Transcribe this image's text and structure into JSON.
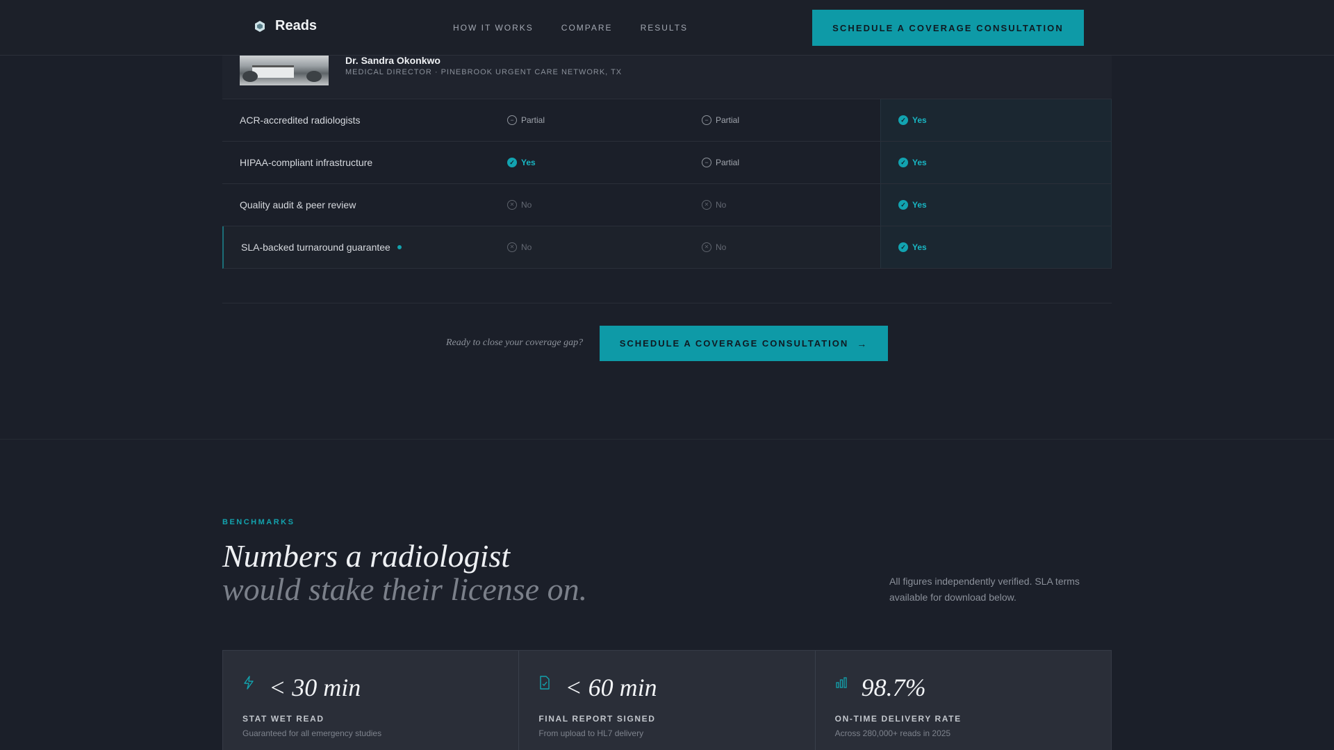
{
  "nav": {
    "brand": "Reads",
    "links": [
      "HOW IT WORKS",
      "COMPARE",
      "RESULTS"
    ],
    "cta": "SCHEDULE A COVERAGE CONSULTATION"
  },
  "testimonial": {
    "name": "Dr. Sandra Okonkwo",
    "role": "MEDICAL DIRECTOR · PINEBROOK URGENT CARE NETWORK, TX"
  },
  "comparison": {
    "rows": [
      {
        "feature": "ACR-accredited radiologists",
        "c1": {
          "status": "partial",
          "label": "Partial"
        },
        "c2": {
          "status": "partial",
          "label": "Partial"
        },
        "c3": {
          "status": "yes",
          "label": "Yes"
        }
      },
      {
        "feature": "HIPAA-compliant infrastructure",
        "c1": {
          "status": "yes",
          "label": "Yes"
        },
        "c2": {
          "status": "partial",
          "label": "Partial"
        },
        "c3": {
          "status": "yes",
          "label": "Yes"
        }
      },
      {
        "feature": "Quality audit & peer review",
        "c1": {
          "status": "no",
          "label": "No"
        },
        "c2": {
          "status": "no",
          "label": "No"
        },
        "c3": {
          "status": "yes",
          "label": "Yes"
        }
      },
      {
        "feature": "SLA-backed turnaround guarantee",
        "c1": {
          "status": "no",
          "label": "No"
        },
        "c2": {
          "status": "no",
          "label": "No"
        },
        "c3": {
          "status": "yes",
          "label": "Yes"
        }
      }
    ]
  },
  "cta": {
    "question": "Ready to close your coverage gap?",
    "button": "SCHEDULE A COVERAGE CONSULTATION"
  },
  "benchmarks": {
    "eyebrow": "BENCHMARKS",
    "headline_line1": "Numbers a radiologist",
    "headline_line2": "would stake their license on.",
    "note": "All figures independently verified. SLA terms available for download below.",
    "cards": [
      {
        "icon": "lightning-icon",
        "value": "< 30 min",
        "label": "STAT WET READ",
        "sub": "Guaranteed for all emergency studies"
      },
      {
        "icon": "document-check-icon",
        "value": "< 60 min",
        "label": "FINAL REPORT SIGNED",
        "sub": "From upload to HL7 delivery"
      },
      {
        "icon": "bar-chart-icon",
        "value": "98.7%",
        "label": "ON-TIME DELIVERY RATE",
        "sub": "Across 280,000+ reads in 2025"
      }
    ]
  },
  "colors": {
    "accent": "#0e9aa7",
    "background": "#1b1f29"
  }
}
